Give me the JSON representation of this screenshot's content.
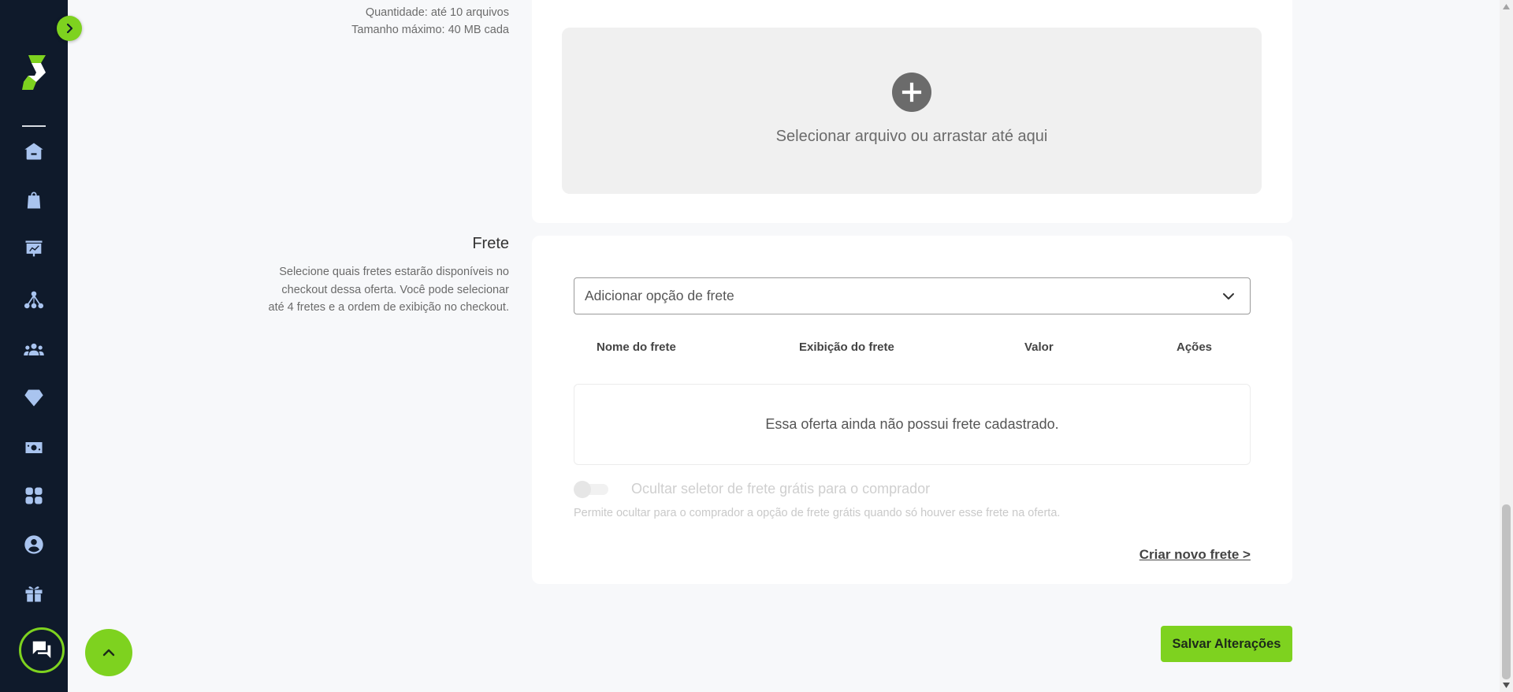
{
  "upload": {
    "quantity": "Quantidade: até 10 arquivos",
    "max_size": "Tamanho máximo: 40 MB cada",
    "dropzone_text": "Selecionar arquivo ou arrastar até aqui"
  },
  "frete": {
    "title": "Frete",
    "description": "Selecione quais fretes estarão disponíveis no checkout dessa oferta. Você pode selecionar até 4 fretes e a ordem de exibição no checkout.",
    "select_placeholder": "Adicionar opção de frete",
    "table_headers": [
      "Nome do frete",
      "Exibição do frete",
      "Valor",
      "Ações"
    ],
    "empty_message": "Essa oferta ainda não possui frete cadastrado.",
    "toggle_label": "Ocultar seletor de frete grátis para o comprador",
    "toggle_on": false,
    "toggle_help": "Permite ocultar para o comprador a opção de frete grátis quando só houver esse frete na oferta.",
    "create_link": "Criar novo frete >"
  },
  "actions": {
    "save_label": "Salvar Alterações"
  },
  "sidebar": {
    "items": [
      {
        "icon": "home-icon"
      },
      {
        "icon": "shopping-bag-icon"
      },
      {
        "icon": "presentation-chart-icon"
      },
      {
        "icon": "network-icon"
      },
      {
        "icon": "users-icon"
      },
      {
        "icon": "diamond-icon"
      },
      {
        "icon": "money-icon"
      },
      {
        "icon": "apps-grid-icon"
      },
      {
        "icon": "account-circle-icon"
      },
      {
        "icon": "gift-icon"
      }
    ]
  },
  "colors": {
    "sidebar_bg": "#0f1a2b",
    "accent": "#7ed21f",
    "nav_icon": "#a9c4ef"
  }
}
